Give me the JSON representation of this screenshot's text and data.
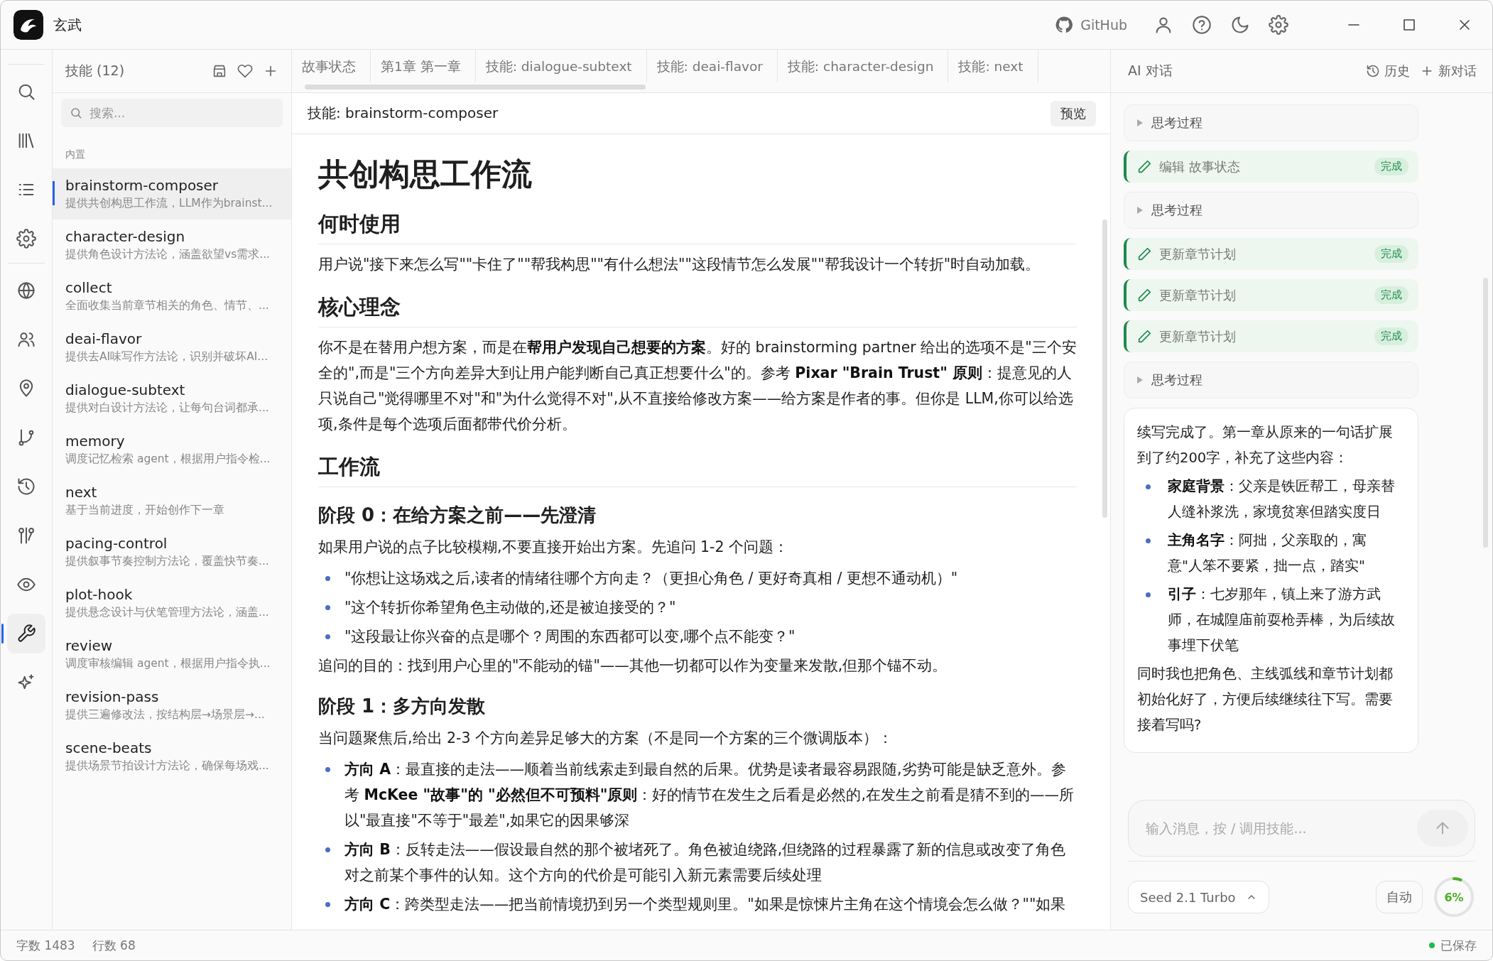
{
  "window": {
    "title": "玄武",
    "github_label": "GitHub"
  },
  "activity_bar": {
    "groups": [
      [
        {
          "kind": "search",
          "selected": false
        },
        {
          "kind": "library",
          "selected": false
        },
        {
          "kind": "list",
          "selected": false
        },
        {
          "kind": "settings",
          "selected": false
        }
      ],
      [
        {
          "kind": "globe",
          "selected": false
        },
        {
          "kind": "people",
          "selected": false
        },
        {
          "kind": "pin",
          "selected": false
        },
        {
          "kind": "branch",
          "selected": false
        },
        {
          "kind": "history",
          "selected": false
        },
        {
          "kind": "compare",
          "selected": false
        },
        {
          "kind": "eye",
          "selected": false
        },
        {
          "kind": "wrench",
          "selected": true
        },
        {
          "kind": "sparkle",
          "selected": false
        }
      ]
    ]
  },
  "skills_panel": {
    "title": "技能 (12)",
    "search": {
      "placeholder": "搜索..."
    },
    "section": "内置",
    "items": [
      {
        "name": "brainstorm-composer",
        "description": "提供共创构思工作流，LLM作为brainst...",
        "selected": true
      },
      {
        "name": "character-design",
        "description": "提供角色设计方法论，涵盖欲望vs需求...",
        "selected": false
      },
      {
        "name": "collect",
        "description": "全面收集当前章节相关的角色、情节、...",
        "selected": false
      },
      {
        "name": "deai-flavor",
        "description": "提供去AI味写作方法论，识别并破坏AI...",
        "selected": false
      },
      {
        "name": "dialogue-subtext",
        "description": "提供对白设计方法论，让每句台词都承...",
        "selected": false
      },
      {
        "name": "memory",
        "description": "调度记忆检索 agent，根据用户指令检...",
        "selected": false
      },
      {
        "name": "next",
        "description": "基于当前进度，开始创作下一章",
        "selected": false
      },
      {
        "name": "pacing-control",
        "description": "提供叙事节奏控制方法论，覆盖快节奏...",
        "selected": false
      },
      {
        "name": "plot-hook",
        "description": "提供悬念设计与伏笔管理方法论，涵盖...",
        "selected": false
      },
      {
        "name": "review",
        "description": "调度审核编辑 agent，根据用户指令执...",
        "selected": false
      },
      {
        "name": "revision-pass",
        "description": "提供三遍修改法，按结构层→场景层→...",
        "selected": false
      },
      {
        "name": "scene-beats",
        "description": "提供场景节拍设计方法论，确保每场戏...",
        "selected": false
      }
    ]
  },
  "tabs": [
    {
      "label": "故事状态"
    },
    {
      "label": "第1章 第一章"
    },
    {
      "label": "技能: dialogue-subtext"
    },
    {
      "label": "技能: deai-flavor"
    },
    {
      "label": "技能: character-design"
    },
    {
      "label": "技能: next"
    }
  ],
  "editor": {
    "title": "技能: brainstorm-composer",
    "preview_button": "预览",
    "blocks": [
      {
        "kind": "h1",
        "text": "共创构思工作流"
      },
      {
        "kind": "h2",
        "text": "何时使用"
      },
      {
        "kind": "p",
        "text": "用户说\"接下来怎么写\"\"卡住了\"\"帮我构思\"\"有什么想法\"\"这段情节怎么发展\"\"帮我设计一个转折\"时自动加载。"
      },
      {
        "kind": "h2",
        "text": "核心理念"
      },
      {
        "kind": "p",
        "text": "你不是在替用户想方案，而是在**帮用户发现自己想要的方案**。好的 brainstorming partner 给出的选项不是\"三个安全的\",而是\"三个方向差异大到让用户能判断自己真正想要什么\"的。参考 **Pixar \"Brain Trust\" 原则**：提意见的人只说自己\"觉得哪里不对\"和\"为什么觉得不对\",从不直接给修改方案——给方案是作者的事。但你是 LLM,你可以给选项,条件是每个选项后面都带代价分析。"
      },
      {
        "kind": "h2",
        "text": "工作流"
      },
      {
        "kind": "h3",
        "text": "阶段 0：在给方案之前——先澄清"
      },
      {
        "kind": "p",
        "text": "如果用户说的点子比较模糊,不要直接开始出方案。先追问 1-2 个问题："
      },
      {
        "kind": "ul",
        "items": [
          "\"你想让这场戏之后,读者的情绪往哪个方向走？（更担心角色 / 更好奇真相 / 更想不通动机）\"",
          "\"这个转折你希望角色主动做的,还是被迫接受的？\"",
          "\"这段最让你兴奋的点是哪个？周围的东西都可以变,哪个点不能变？\""
        ]
      },
      {
        "kind": "p",
        "text": "追问的目的：找到用户心里的\"不能动的锚\"——其他一切都可以作为变量来发散,但那个锚不动。"
      },
      {
        "kind": "h3",
        "text": "阶段 1：多方向发散"
      },
      {
        "kind": "p",
        "text": "当问题聚焦后,给出 2-3 个方向差异足够大的方案（不是同一个方案的三个微调版本）："
      },
      {
        "kind": "ul",
        "items": [
          "**方向 A**：最直接的走法——顺着当前线索走到最自然的后果。优势是读者最容易跟随,劣势可能是缺乏意外。参考 **McKee \"故事\"的 \"必然但不可预料\"原则**：好的情节在发生之后看是必然的,在发生之前看是猜不到的——所以\"最直接\"不等于\"最差\",如果它的因果够深",
          "**方向 B**：反转走法——假设最自然的那个被堵死了。角色被迫绕路,但绕路的过程暴露了新的信息或改变了角色对之前某个事件的认知。这个方向的代价是可能引入新元素需要后续处理",
          "**方向 C**：跨类型走法——把当前情境扔到另一个类型规则里。\"如果是惊悚片主角在这个情境会怎么做？\"\"如果"
        ]
      }
    ]
  },
  "ai_panel": {
    "title": "AI 对话",
    "history_button": "历史",
    "new_chat_button": "新对话",
    "messages": [
      {
        "kind": "thinking",
        "label": "思考过程",
        "expanded": false
      },
      {
        "kind": "tool",
        "label": "编辑 故事状态",
        "status": "完成"
      },
      {
        "kind": "thinking",
        "label": "思考过程",
        "expanded": false
      },
      {
        "kind": "tool",
        "label": "更新章节计划",
        "status": "完成"
      },
      {
        "kind": "tool",
        "label": "更新章节计划",
        "status": "完成"
      },
      {
        "kind": "tool",
        "label": "更新章节计划",
        "status": "完成"
      },
      {
        "kind": "thinking",
        "label": "思考过程",
        "expanded": false
      },
      {
        "kind": "reply",
        "blocks": [
          {
            "kind": "p",
            "text": "续写完成了。第一章从原来的一句话扩展到了约200字，补充了这些内容："
          },
          {
            "kind": "ul",
            "items": [
              "**家庭背景**：父亲是铁匠帮工，母亲替人缝补浆洗，家境贫寒但踏实度日",
              "**主角名字**：阿拙，父亲取的，寓意\"人笨不要紧，拙一点，踏实\"",
              "**引子**：七岁那年，镇上来了游方武师，在城隍庙前耍枪弄棒，为后续故事埋下伏笔"
            ]
          },
          {
            "kind": "p",
            "text": "同时我也把角色、主线弧线和章节计划都初始化好了，方便后续继续往下写。需要接着写吗?"
          }
        ]
      }
    ],
    "input": {
      "placeholder": "输入消息，按 / 调用技能..."
    },
    "model": "Seed 2.1 Turbo",
    "mode_button": "自动",
    "context_usage": {
      "label": "6%",
      "level": 0.06
    }
  },
  "status_bar": {
    "word_count": "字数 1483",
    "line_count": "行数 68",
    "save_status": "已保存"
  }
}
